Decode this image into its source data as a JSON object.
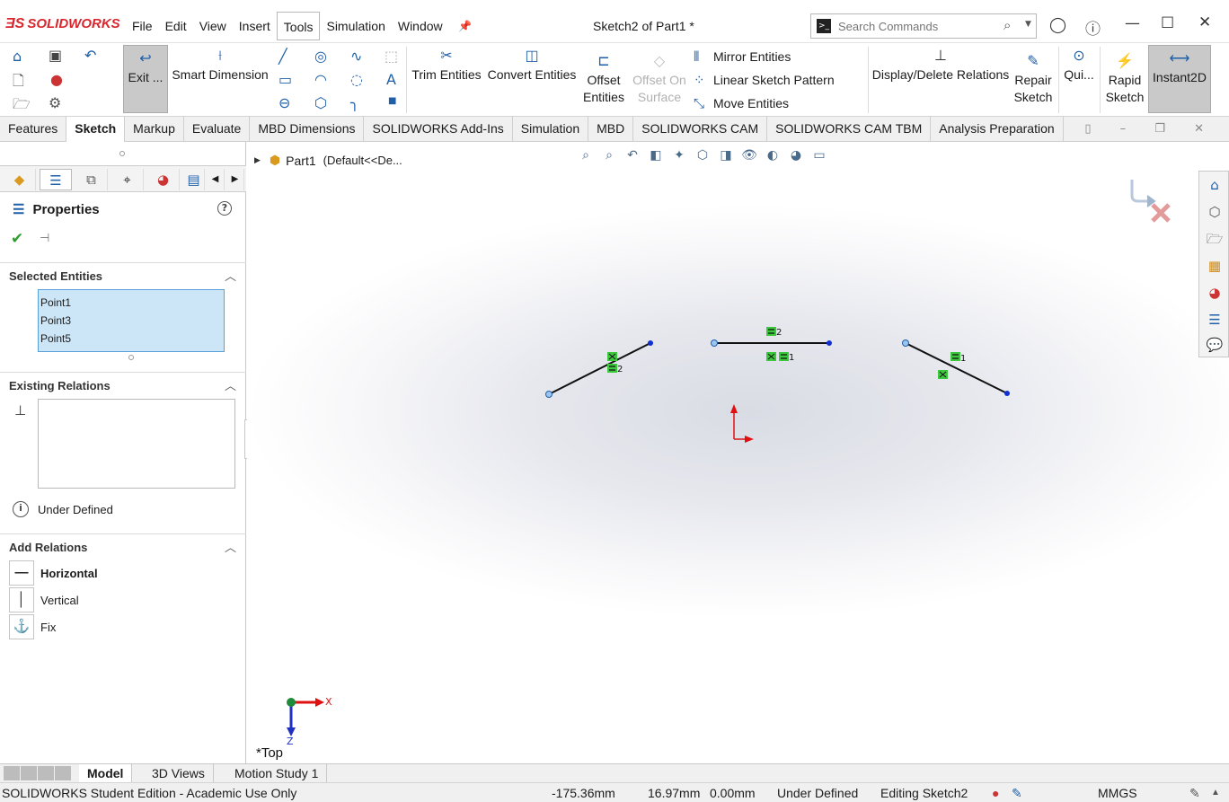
{
  "app": {
    "brand": "SOLIDWORKS",
    "doc_title": "Sketch2 of Part1 *"
  },
  "menu": [
    "File",
    "Edit",
    "View",
    "Insert",
    "Tools",
    "Simulation",
    "Window"
  ],
  "search": {
    "placeholder": "Search Commands"
  },
  "ribbon": {
    "exit_sketch": "Exit ...",
    "smart_dimension": "Smart Dimension",
    "trim_entities": "Trim Entities",
    "convert_entities": "Convert Entities",
    "offset_entities_1": "Offset",
    "offset_entities_2": "Entities",
    "offset_on_surface_1": "Offset On",
    "offset_on_surface_2": "Surface",
    "mirror_entities": "Mirror Entities",
    "linear_sketch_pattern": "Linear Sketch Pattern",
    "move_entities": "Move Entities",
    "display_delete_relations": "Display/Delete Relations",
    "repair_sketch_1": "Repair",
    "repair_sketch_2": "Sketch",
    "quick_snaps": "Qui...",
    "rapid_sketch_1": "Rapid",
    "rapid_sketch_2": "Sketch",
    "instant2d": "Instant2D"
  },
  "tabs": [
    "Features",
    "Sketch",
    "Markup",
    "Evaluate",
    "MBD Dimensions",
    "SOLIDWORKS Add-Ins",
    "Simulation",
    "MBD",
    "SOLIDWORKS CAM",
    "SOLIDWORKS CAM TBM",
    "Analysis Preparation"
  ],
  "panel": {
    "title": "Properties",
    "selected_entities": {
      "label": "Selected Entities",
      "items": [
        "Point1",
        "Point3",
        "Point5"
      ]
    },
    "existing_relations": {
      "label": "Existing Relations"
    },
    "status": "Under Defined",
    "add_relations": {
      "label": "Add Relations",
      "items": [
        "Horizontal",
        "Vertical",
        "Fix"
      ]
    }
  },
  "graphics": {
    "tree_root": "Part1",
    "tree_config": "(Default<<De...",
    "view_label": "*Top",
    "triad_x": "X",
    "triad_z": "Z",
    "relation_labels": {
      "left": "2",
      "middle_top": "2",
      "middle_bottom": "1",
      "right": "1"
    }
  },
  "bottom_tabs": [
    "Model",
    "3D Views",
    "Motion Study 1"
  ],
  "status": {
    "edition": "SOLIDWORKS Student Edition - Academic Use Only",
    "x": "-175.36mm",
    "y": "16.97mm",
    "z": "0.00mm",
    "definition": "Under Defined",
    "editing": "Editing Sketch2",
    "units": "MMGS"
  },
  "colors": {
    "brand_red": "#d7282f",
    "selection_blue": "#cde6f7",
    "relation_green": "#3cc83c",
    "origin_red": "#e01010"
  }
}
